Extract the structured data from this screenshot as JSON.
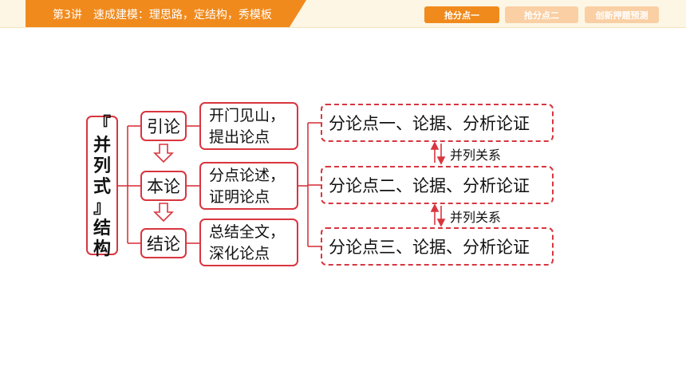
{
  "header": {
    "title": "第3讲　速成建模：理思路，定结构，秀模板",
    "nav": [
      "抢分点一",
      "抢分点二",
      "创新押题预测"
    ]
  },
  "diagram": {
    "root_chars": [
      "『",
      "并",
      "列",
      "式",
      "』",
      "结",
      "构"
    ],
    "sections": [
      {
        "label": "引论",
        "desc_lines": [
          "开门见山，",
          "提出论点"
        ]
      },
      {
        "label": "本论",
        "desc_lines": [
          "分点论述，",
          "证明论点"
        ]
      },
      {
        "label": "结论",
        "desc_lines": [
          "总结全文，",
          "深化论点"
        ]
      }
    ],
    "points": [
      "分论点一、论据、分析论证",
      "分论点二、论据、分析论证",
      "分论点三、论据、分析论证"
    ],
    "relations": [
      "并列关系",
      "并列关系"
    ]
  },
  "colors": {
    "accent": "#f08a1c",
    "accent_light": "#f9cfa3",
    "diagram_red": "#d8363f",
    "header_bg": "#fdf6e4"
  }
}
